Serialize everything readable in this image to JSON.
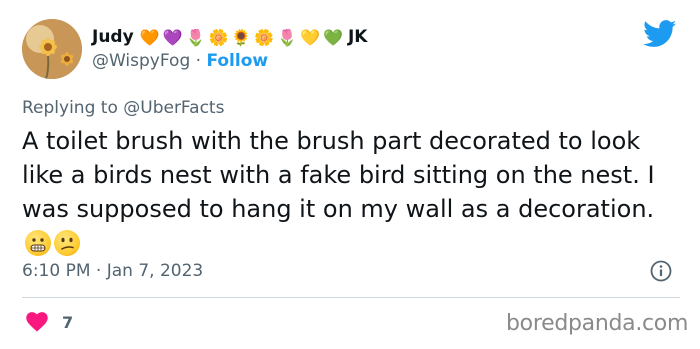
{
  "author": {
    "display_name": "Judy",
    "name_emojis": [
      "🧡",
      "💜",
      "🌷",
      "🌼",
      "🌻",
      "🌼",
      "🌷",
      "💛",
      "💚"
    ],
    "name_suffix": "JK",
    "handle": "@WispyFog",
    "separator": " · ",
    "follow_label": "Follow"
  },
  "reply": {
    "prefix": "Replying to ",
    "mention": "@UberFacts"
  },
  "tweet": {
    "text": "A toilet brush with the brush part decorated to look like a birds nest with a fake bird sitting on the nest. I was supposed to hang it on my wall as a decoration.",
    "emojis": [
      "grimacing-face",
      "confused-face"
    ],
    "timestamp": "6:10 PM · Jan 7, 2023"
  },
  "engagement": {
    "like_count": "7"
  },
  "watermark": "boredpanda.com",
  "colors": {
    "brand_blue": "#1d9bf0",
    "secondary_text": "#536471",
    "heart": "#f91880"
  },
  "icons": [
    "twitter-bird-icon",
    "info-icon",
    "heart-icon"
  ]
}
